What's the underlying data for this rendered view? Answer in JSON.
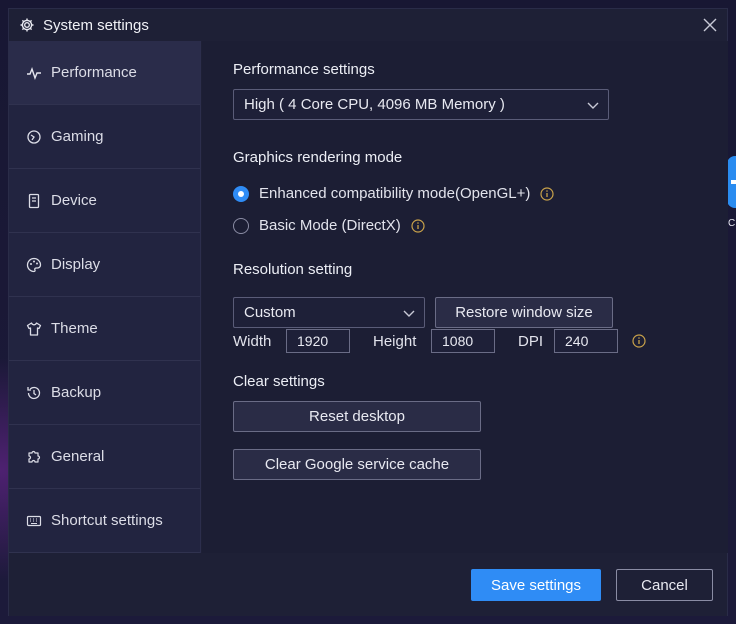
{
  "window": {
    "title": "System settings"
  },
  "sidebar": {
    "items": [
      {
        "label": "Performance",
        "icon": "pulse-icon"
      },
      {
        "label": "Gaming",
        "icon": "gaming-icon"
      },
      {
        "label": "Device",
        "icon": "device-icon"
      },
      {
        "label": "Display",
        "icon": "palette-icon"
      },
      {
        "label": "Theme",
        "icon": "shirt-icon"
      },
      {
        "label": "Backup",
        "icon": "backup-icon"
      },
      {
        "label": "General",
        "icon": "puzzle-icon"
      },
      {
        "label": "Shortcut settings",
        "icon": "keyboard-icon"
      }
    ],
    "active_index": 0
  },
  "performance": {
    "title": "Performance settings",
    "preset": "High ( 4 Core CPU, 4096 MB Memory )"
  },
  "graphics": {
    "title": "Graphics rendering mode",
    "options": [
      {
        "label": "Enhanced compatibility mode(OpenGL+)",
        "selected": true
      },
      {
        "label": "Basic Mode (DirectX)",
        "selected": false
      }
    ]
  },
  "resolution": {
    "title": "Resolution setting",
    "preset": "Custom",
    "restore_label": "Restore window size",
    "width_label": "Width",
    "width_value": "1920",
    "height_label": "Height",
    "height_value": "1080",
    "dpi_label": "DPI",
    "dpi_value": "240"
  },
  "clear": {
    "title": "Clear settings",
    "reset_label": "Reset desktop",
    "cache_label": "Clear Google service cache"
  },
  "footer": {
    "save_label": "Save settings",
    "cancel_label": "Cancel"
  },
  "desktop": {
    "peek_text": "C"
  },
  "colors": {
    "accent": "#2f8cf5",
    "window_bg": "#1e2036",
    "sidebar_bg": "#222440",
    "active_item_bg": "#2a2c4a"
  }
}
